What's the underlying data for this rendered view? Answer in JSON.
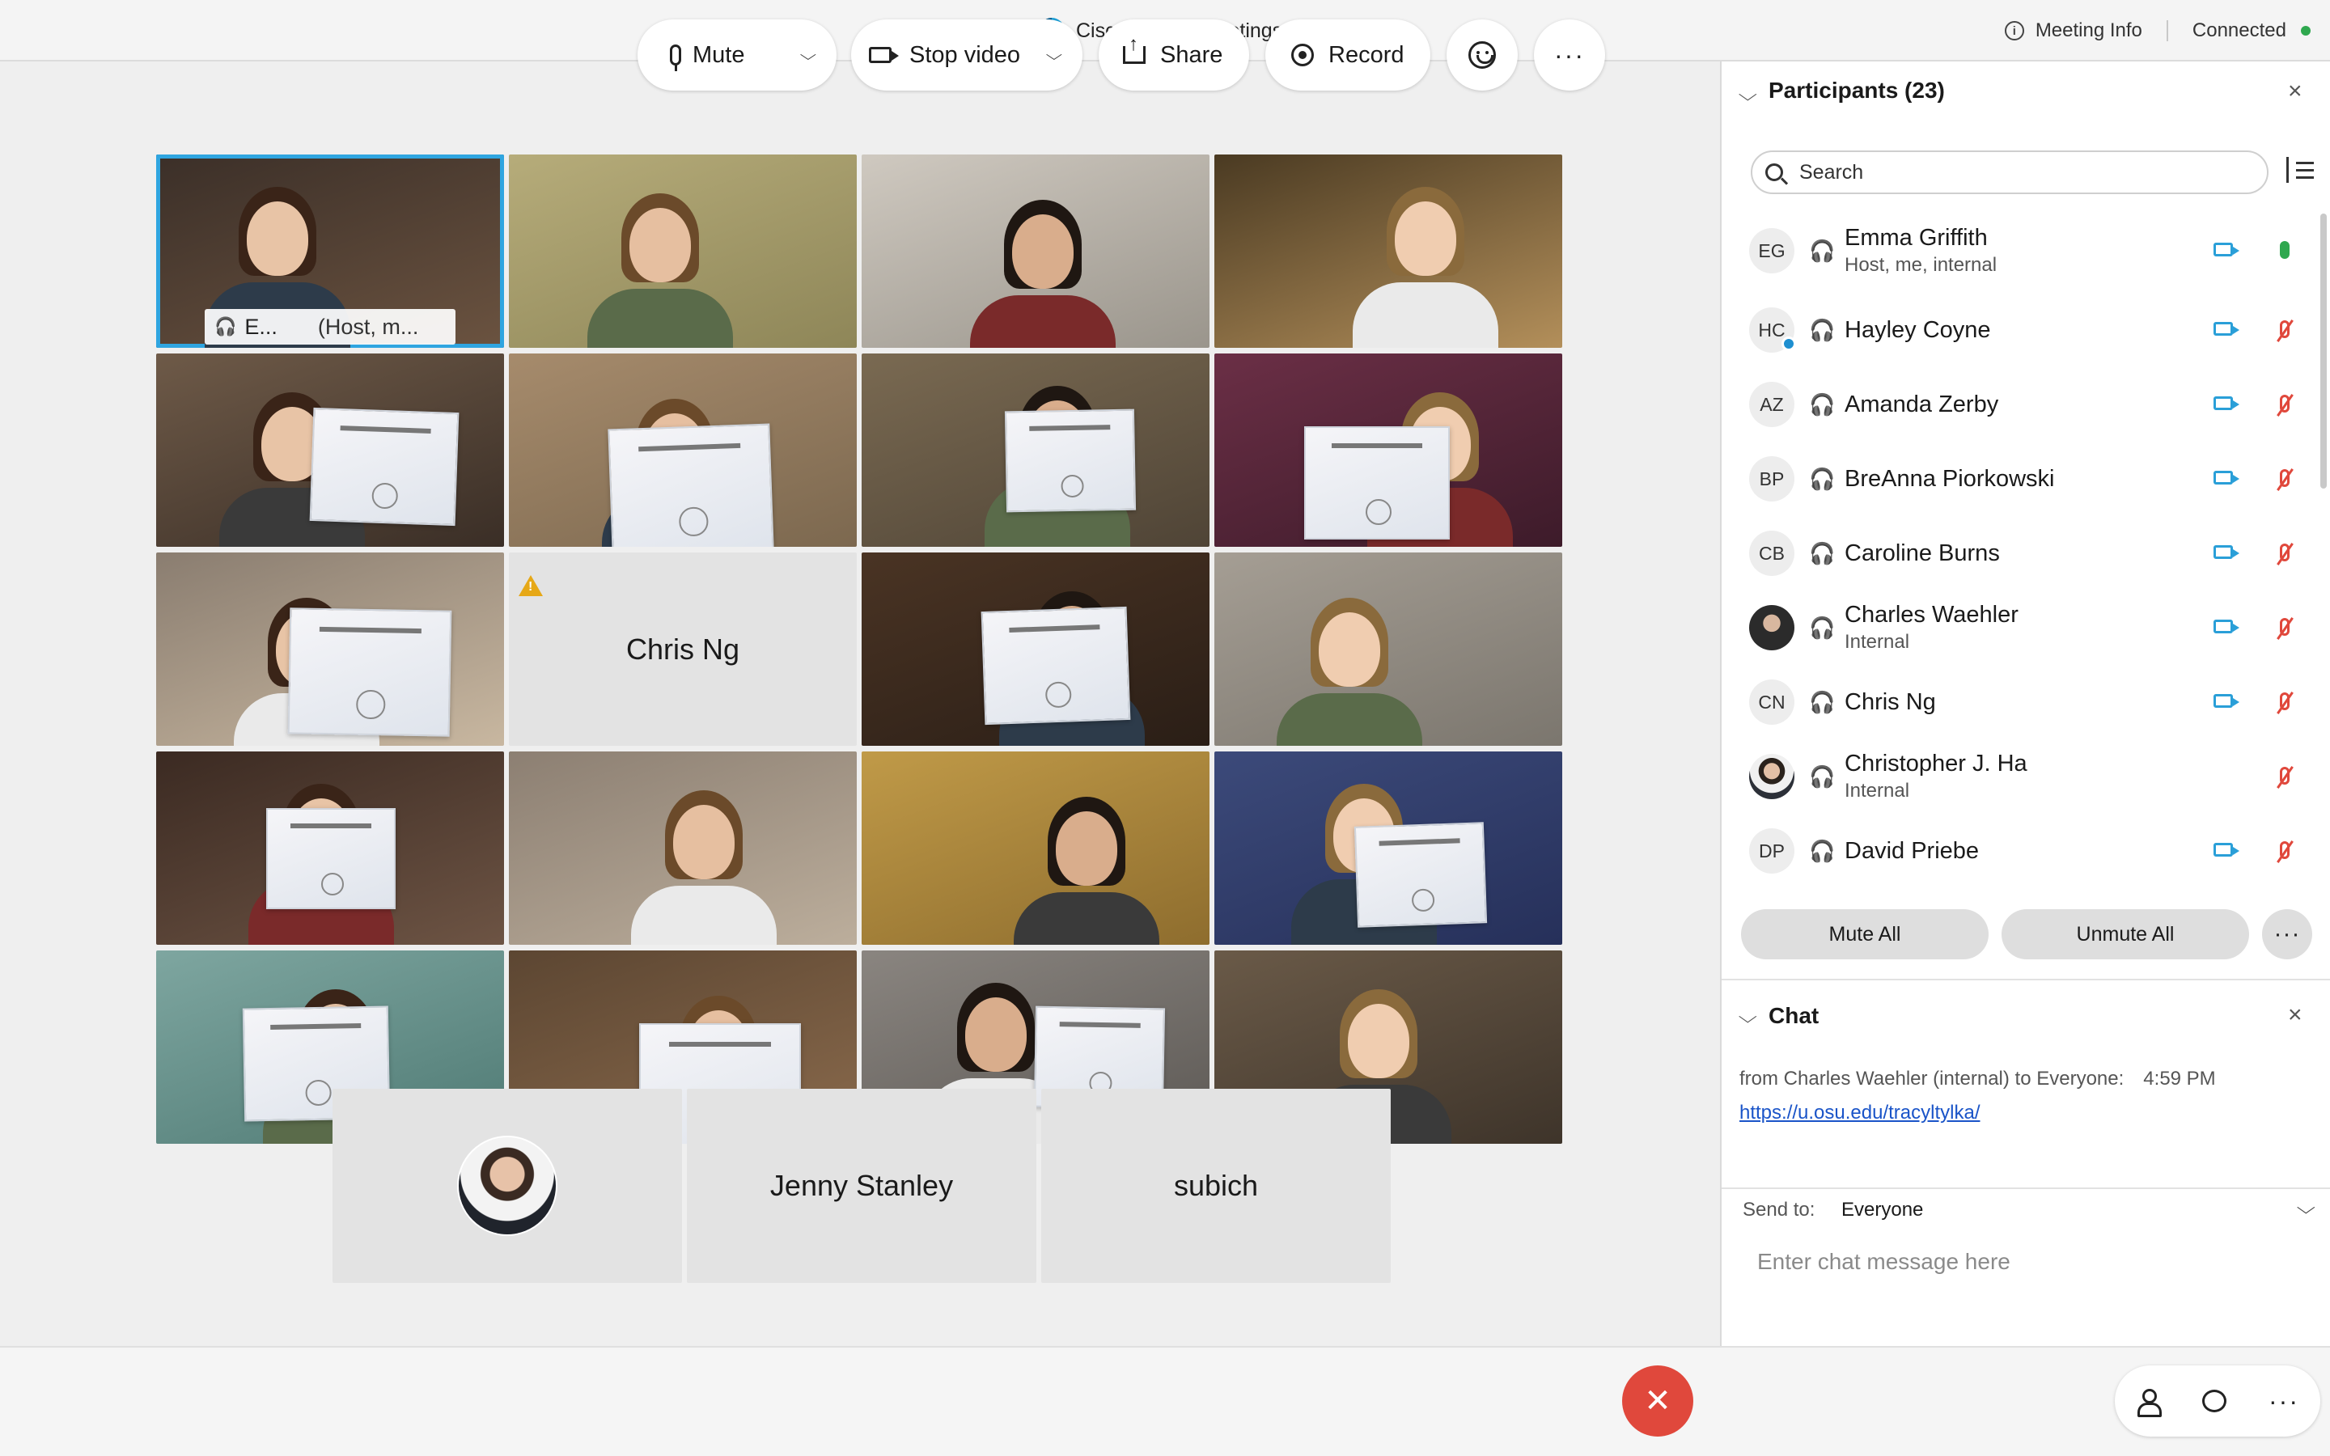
{
  "app": {
    "title": "Cisco Webex Meetings",
    "meeting_info_label": "Meeting Info",
    "connection_status": "Connected"
  },
  "video_grid": {
    "tiles": [
      {
        "type": "video",
        "active": true,
        "name_tag": "E...",
        "name_tag_role": "(Host, m..."
      },
      {
        "type": "video"
      },
      {
        "type": "video"
      },
      {
        "type": "video"
      },
      {
        "type": "video",
        "holding_certificate": true
      },
      {
        "type": "video",
        "holding_certificate": true
      },
      {
        "type": "video",
        "holding_certificate": true
      },
      {
        "type": "video",
        "holding_certificate": true
      },
      {
        "type": "video",
        "holding_certificate": true
      },
      {
        "type": "name-only",
        "name": "Chris Ng",
        "warning": true
      },
      {
        "type": "video",
        "holding_certificate": true
      },
      {
        "type": "video"
      },
      {
        "type": "video",
        "holding_certificate": true
      },
      {
        "type": "video"
      },
      {
        "type": "video"
      },
      {
        "type": "video",
        "holding_certificate": true
      },
      {
        "type": "video",
        "holding_certificate": true
      },
      {
        "type": "video",
        "holding_certificate": true
      },
      {
        "type": "video",
        "holding_certificate": true
      },
      {
        "type": "video"
      }
    ],
    "bottom_row": [
      {
        "type": "avatar"
      },
      {
        "type": "name-only",
        "name": "Jenny Stanley"
      },
      {
        "type": "name-only",
        "name": "subich"
      }
    ]
  },
  "participants_panel": {
    "title": "Participants (23)",
    "search_placeholder": "Search",
    "participants": [
      {
        "initials": "EG",
        "name": "Emma Griffith",
        "subtitle": "Host, me, internal",
        "video": true,
        "mic": "on"
      },
      {
        "initials": "HC",
        "name": "Hayley Coyne",
        "subtitle": "",
        "video": true,
        "mic": "muted",
        "badge": true
      },
      {
        "initials": "AZ",
        "name": "Amanda Zerby",
        "subtitle": "",
        "video": true,
        "mic": "muted"
      },
      {
        "initials": "BP",
        "name": "BreAnna Piorkowski",
        "subtitle": "",
        "video": true,
        "mic": "muted"
      },
      {
        "initials": "CB",
        "name": "Caroline Burns",
        "subtitle": "",
        "video": true,
        "mic": "muted"
      },
      {
        "initials": "",
        "name": "Charles Waehler",
        "subtitle": "Internal",
        "video": true,
        "mic": "muted",
        "photo": "photo"
      },
      {
        "initials": "CN",
        "name": "Chris Ng",
        "subtitle": "",
        "video": true,
        "mic": "muted"
      },
      {
        "initials": "",
        "name": "Christopher J. Ha",
        "subtitle": "Internal",
        "video": false,
        "mic": "muted",
        "photo": "photo2"
      },
      {
        "initials": "DP",
        "name": "David Priebe",
        "subtitle": "",
        "video": true,
        "mic": "muted"
      }
    ],
    "mute_all_label": "Mute All",
    "unmute_all_label": "Unmute All",
    "more_label": "···"
  },
  "chat_panel": {
    "title": "Chat",
    "messages": [
      {
        "meta": "from Charles Waehler (internal) to Everyone:",
        "time": "4:59  PM",
        "text": "https://u.osu.edu/tracyltylka/"
      }
    ],
    "send_to_label": "Send to:",
    "send_to_value": "Everyone",
    "input_placeholder": "Enter chat message here"
  },
  "toolbar": {
    "mute_label": "Mute",
    "stop_video_label": "Stop video",
    "share_label": "Share",
    "record_label": "Record",
    "more_label": "···",
    "end_label": "✕",
    "right_more_label": "···"
  },
  "colors": {
    "accent": "#2fa5e0",
    "end_call": "#e0483c",
    "muted_mic": "#e0483c",
    "active_mic": "#2fa84f",
    "camera": "#2a9fd8",
    "link": "#1a54c8"
  }
}
